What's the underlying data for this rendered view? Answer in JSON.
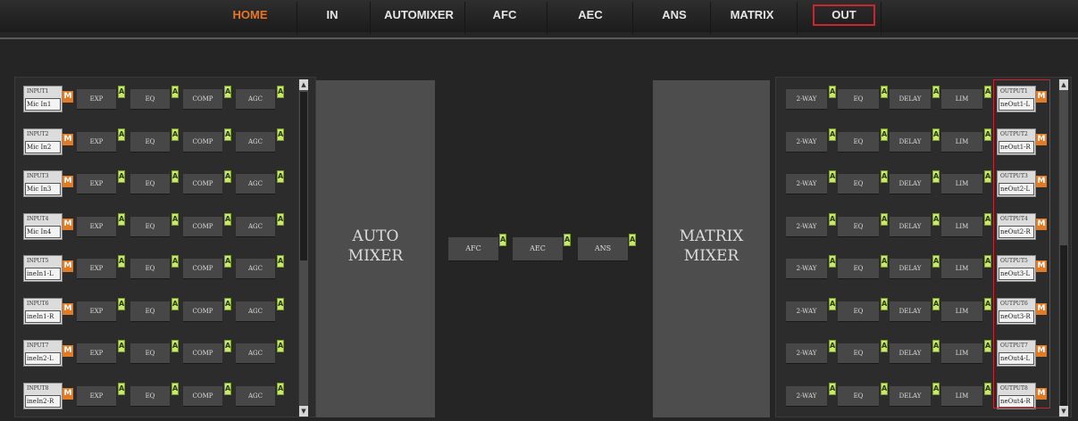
{
  "nav": {
    "tabs": [
      {
        "label": "HOME",
        "active": true
      },
      {
        "label": "IN"
      },
      {
        "label": "AUTOMIXER"
      },
      {
        "label": "AFC"
      },
      {
        "label": "AEC"
      },
      {
        "label": "ANS"
      },
      {
        "label": "MATRIX"
      },
      {
        "label": "OUT",
        "outlined": true
      }
    ]
  },
  "inputs": [
    {
      "id": "INPUT1",
      "name": "Mic In1"
    },
    {
      "id": "INPUT2",
      "name": "Mic In2"
    },
    {
      "id": "INPUT3",
      "name": "Mic In3"
    },
    {
      "id": "INPUT4",
      "name": "Mic In4"
    },
    {
      "id": "INPUT5",
      "name": "ineIn1-L"
    },
    {
      "id": "INPUT6",
      "name": "ineIn1-R"
    },
    {
      "id": "INPUT7",
      "name": "ineIn2-L"
    },
    {
      "id": "INPUT8",
      "name": "ineIn2-R"
    }
  ],
  "input_modules": [
    "EXP",
    "EQ",
    "COMP",
    "AGC"
  ],
  "outputs": [
    {
      "id": "OUTPUT1",
      "name": "neOut1-L"
    },
    {
      "id": "OUTPUT2",
      "name": "neOut1-R"
    },
    {
      "id": "OUTPUT3",
      "name": "neOut2-L"
    },
    {
      "id": "OUTPUT4",
      "name": "neOut2-R"
    },
    {
      "id": "OUTPUT5",
      "name": "neOut3-L"
    },
    {
      "id": "OUTPUT6",
      "name": "neOut3-R"
    },
    {
      "id": "OUTPUT7",
      "name": "neOut4-L"
    },
    {
      "id": "OUTPUT8",
      "name": "neOut4-R"
    }
  ],
  "output_modules": [
    "2-WAY",
    "EQ",
    "DELAY",
    "LIM"
  ],
  "mute_label": "M",
  "active_label": "A",
  "automixer": {
    "line1": "AUTO",
    "line2": "MIXER"
  },
  "matrix_mixer": {
    "line1": "MATRIX",
    "line2": "MIXER"
  },
  "middle_chain": [
    "AFC",
    "AEC",
    "ANS"
  ],
  "colors": {
    "accent": "#e8761f",
    "mute": "#e07b27",
    "active_indicator": "#c8ea6c",
    "highlight": "#c8282d"
  }
}
